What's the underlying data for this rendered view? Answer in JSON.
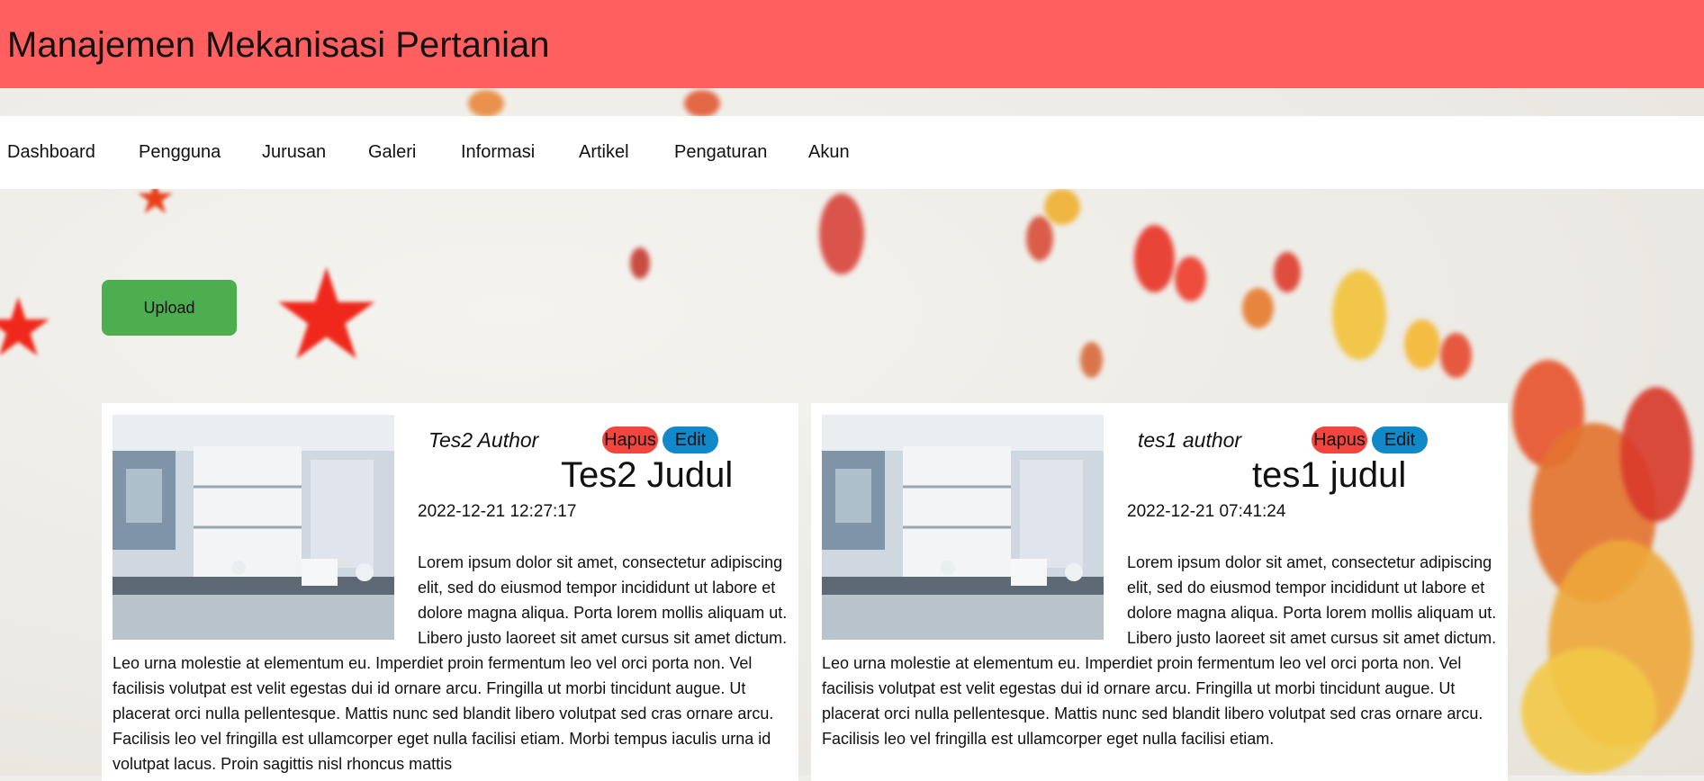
{
  "app": {
    "title": "Manajemen Mekanisasi Pertanian"
  },
  "nav": {
    "items": [
      {
        "label": "Dashboard"
      },
      {
        "label": "Pengguna"
      },
      {
        "label": "Jurusan"
      },
      {
        "label": "Galeri"
      },
      {
        "label": "Informasi"
      },
      {
        "label": "Artikel"
      },
      {
        "label": "Pengaturan"
      },
      {
        "label": "Akun"
      }
    ]
  },
  "toolbar": {
    "upload_label": "Upload"
  },
  "articles": [
    {
      "author": "Tes2 Author",
      "delete_label": "Hapus",
      "edit_label": "Edit",
      "title": "Tes2 Judul",
      "date": "2022-12-21 12:27:17",
      "body": "Lorem ipsum dolor sit amet, consectetur adipiscing elit, sed do eiusmod tempor incididunt ut labore et dolore magna aliqua. Porta lorem mollis aliquam ut. Libero justo laoreet sit amet cursus sit amet dictum. Leo urna molestie at elementum eu. Imperdiet proin fermentum leo vel orci porta non. Vel facilisis volutpat est velit egestas dui id ornare arcu. Fringilla ut morbi tincidunt augue. Ut placerat orci nulla pellentesque. Mattis nunc sed blandit libero volutpat sed cras ornare arcu. Facilisis leo vel fringilla est ullamcorper eget nulla facilisi etiam. Morbi tempus iaculis urna id volutpat lacus. Proin sagittis nisl rhoncus mattis"
    },
    {
      "author": "tes1 author",
      "delete_label": "Hapus",
      "edit_label": "Edit",
      "title": "tes1 judul",
      "date": "2022-12-21 07:41:24",
      "body": "Lorem ipsum dolor sit amet, consectetur adipiscing elit, sed do eiusmod tempor incididunt ut labore et dolore magna aliqua. Porta lorem mollis aliquam ut. Libero justo laoreet sit amet cursus sit amet dictum. Leo urna molestie at elementum eu. Imperdiet proin fermentum leo vel orci porta non. Vel facilisis volutpat est velit egestas dui id ornare arcu. Fringilla ut morbi tincidunt augue. Ut placerat orci nulla pellentesque. Mattis nunc sed blandit libero volutpat sed cras ornare arcu. Facilisis leo vel fringilla est ullamcorper eget nulla facilisi etiam."
    }
  ],
  "colors": {
    "header_bg": "#ff5f5f",
    "upload_bg": "#4cae4f",
    "delete_bg": "#f2453d",
    "edit_bg": "#1188c8"
  }
}
